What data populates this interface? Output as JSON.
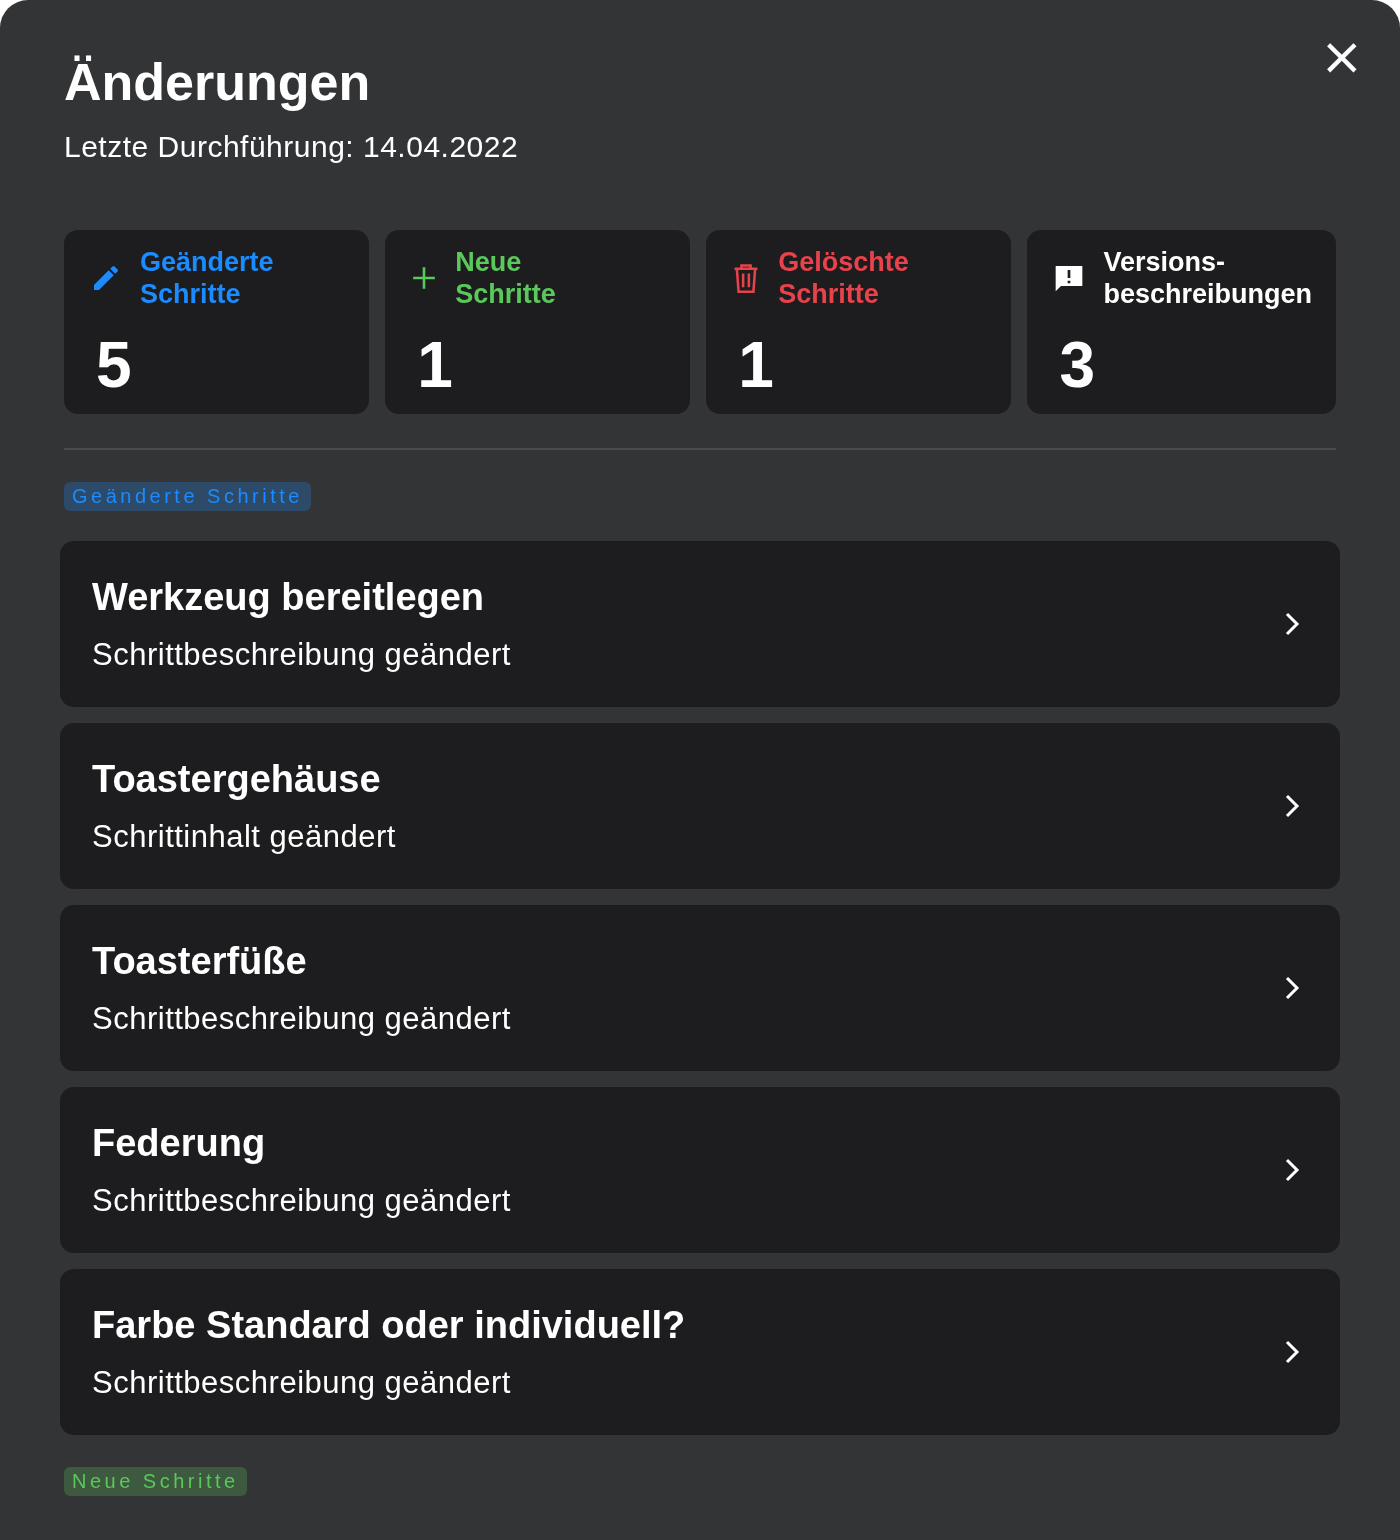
{
  "dialog": {
    "title": "Änderungen",
    "subtitle": "Letzte Durchführung: 14.04.2022",
    "close_icon": "×"
  },
  "stats": [
    {
      "kind": "edited",
      "label": "Geänderte Schritte",
      "count": "5",
      "color": "#1a8cff"
    },
    {
      "kind": "new",
      "label": "Neue Schritte",
      "count": "1",
      "color": "#5ac85a"
    },
    {
      "kind": "deleted",
      "label": "Gelöschte Schritte",
      "count": "1",
      "color": "#e8424a"
    },
    {
      "kind": "versions",
      "label": "Versions- beschreibungen",
      "count": "3",
      "color": "#ffffff"
    }
  ],
  "sections": [
    {
      "label": "Geänderte Schritte",
      "kind": "changed",
      "steps": [
        {
          "title": "Werkzeug bereitlegen",
          "detail": "Schrittbeschreibung geändert"
        },
        {
          "title": "Toastergehäuse",
          "detail": "Schrittinhalt geändert"
        },
        {
          "title": "Toasterfüße",
          "detail": "Schrittbeschreibung geändert"
        },
        {
          "title": "Federung",
          "detail": "Schrittbeschreibung geändert"
        },
        {
          "title": "Farbe Standard oder individuell?",
          "detail": "Schrittbeschreibung geändert"
        }
      ]
    },
    {
      "label": "Neue Schritte",
      "kind": "new"
    }
  ]
}
